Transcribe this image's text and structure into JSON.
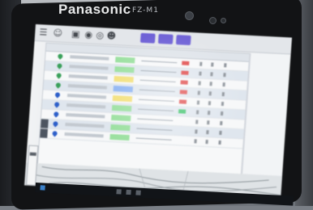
{
  "device": {
    "brand": "Panasonic",
    "model": "FZ-M1"
  },
  "colors": {
    "status_green": "#9be0a0",
    "status_yellow": "#f3e07a",
    "status_blue": "#8eb4f2",
    "pin_green": "#3aa05a",
    "pin_blue": "#2d5fc9",
    "flag_red": "#e04848",
    "flag_green": "#3ec36b",
    "toolbar_purple": "#6f62d6"
  },
  "toolbar": {
    "icons": [
      "menu-icon",
      "person-icon",
      "save-icon",
      "camera-icon",
      "layers-icon",
      "person-group-icon"
    ]
  },
  "table": {
    "rows": [
      {
        "pin": "green",
        "status": "green",
        "flag": "red",
        "dark": false
      },
      {
        "pin": "green",
        "status": "green",
        "flag": "red",
        "dark": false
      },
      {
        "pin": "green",
        "status": "yellow",
        "flag": "red",
        "dark": false
      },
      {
        "pin": "green",
        "status": "blue",
        "flag": "red",
        "dark": false
      },
      {
        "pin": "blue",
        "status": "yellow",
        "flag": "red",
        "dark": false
      },
      {
        "pin": "blue",
        "status": "green",
        "flag": "green",
        "dark": false
      },
      {
        "pin": "blue",
        "status": "green",
        "flag": "none",
        "dark": false
      },
      {
        "pin": "blue",
        "status": "green",
        "flag": "none",
        "dark": true
      },
      {
        "pin": "blue",
        "status": "green",
        "flag": "none",
        "dark": true
      }
    ]
  }
}
